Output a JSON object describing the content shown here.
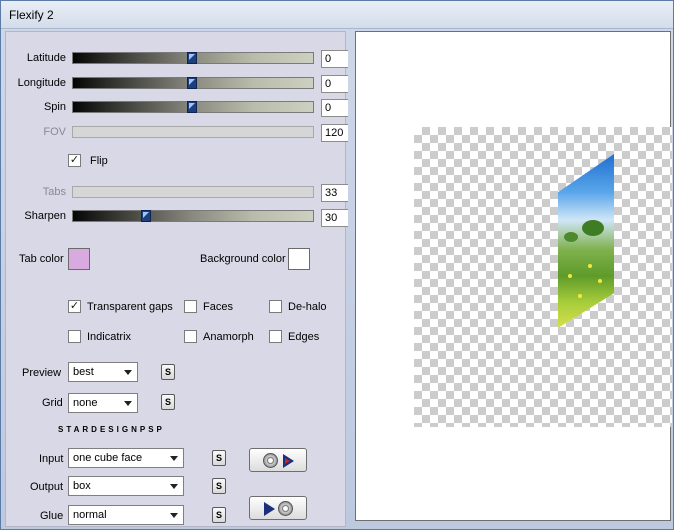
{
  "window": {
    "title": "Flexify 2"
  },
  "sliders": [
    {
      "label": "Latitude",
      "value": "0",
      "enabled": true,
      "level": 0.5
    },
    {
      "label": "Longitude",
      "value": "0",
      "enabled": true,
      "level": 0.5
    },
    {
      "label": "Spin",
      "value": "0",
      "enabled": true,
      "level": 0.5
    },
    {
      "label": "FOV",
      "value": "120",
      "enabled": false
    },
    {
      "label": "Tabs",
      "value": "33",
      "enabled": false
    },
    {
      "label": "Sharpen",
      "value": "30",
      "enabled": true,
      "level": 0.3
    }
  ],
  "flip": {
    "label": "Flip",
    "checked": true
  },
  "tab_color": {
    "label": "Tab color",
    "color": "#d9aadf"
  },
  "background_color": {
    "label": "Background color",
    "color": "#ffffff"
  },
  "options": [
    {
      "label": "Transparent gaps",
      "checked": true
    },
    {
      "label": "Faces",
      "checked": false
    },
    {
      "label": "De-halo",
      "checked": false
    },
    {
      "label": "Indicatrix",
      "checked": false
    },
    {
      "label": "Anamorph",
      "checked": false
    },
    {
      "label": "Edges",
      "checked": false
    }
  ],
  "preview_select": {
    "label": "Preview",
    "value": "best"
  },
  "grid_select": {
    "label": "Grid",
    "value": "none"
  },
  "brand_text": "STARDESIGNPSP",
  "input_select": {
    "label": "Input",
    "value": "one cube face"
  },
  "output_select": {
    "label": "Output",
    "value": "box"
  },
  "glue_select": {
    "label": "Glue",
    "value": "normal"
  },
  "s_button_label": "S",
  "icons": {
    "slider_thumb": "slider-thumb-icon",
    "check": "checkmark-icon",
    "dropdown": "chevron-down-icon",
    "input_image": "disc-play-icon",
    "output_image": "play-disc-icon"
  }
}
